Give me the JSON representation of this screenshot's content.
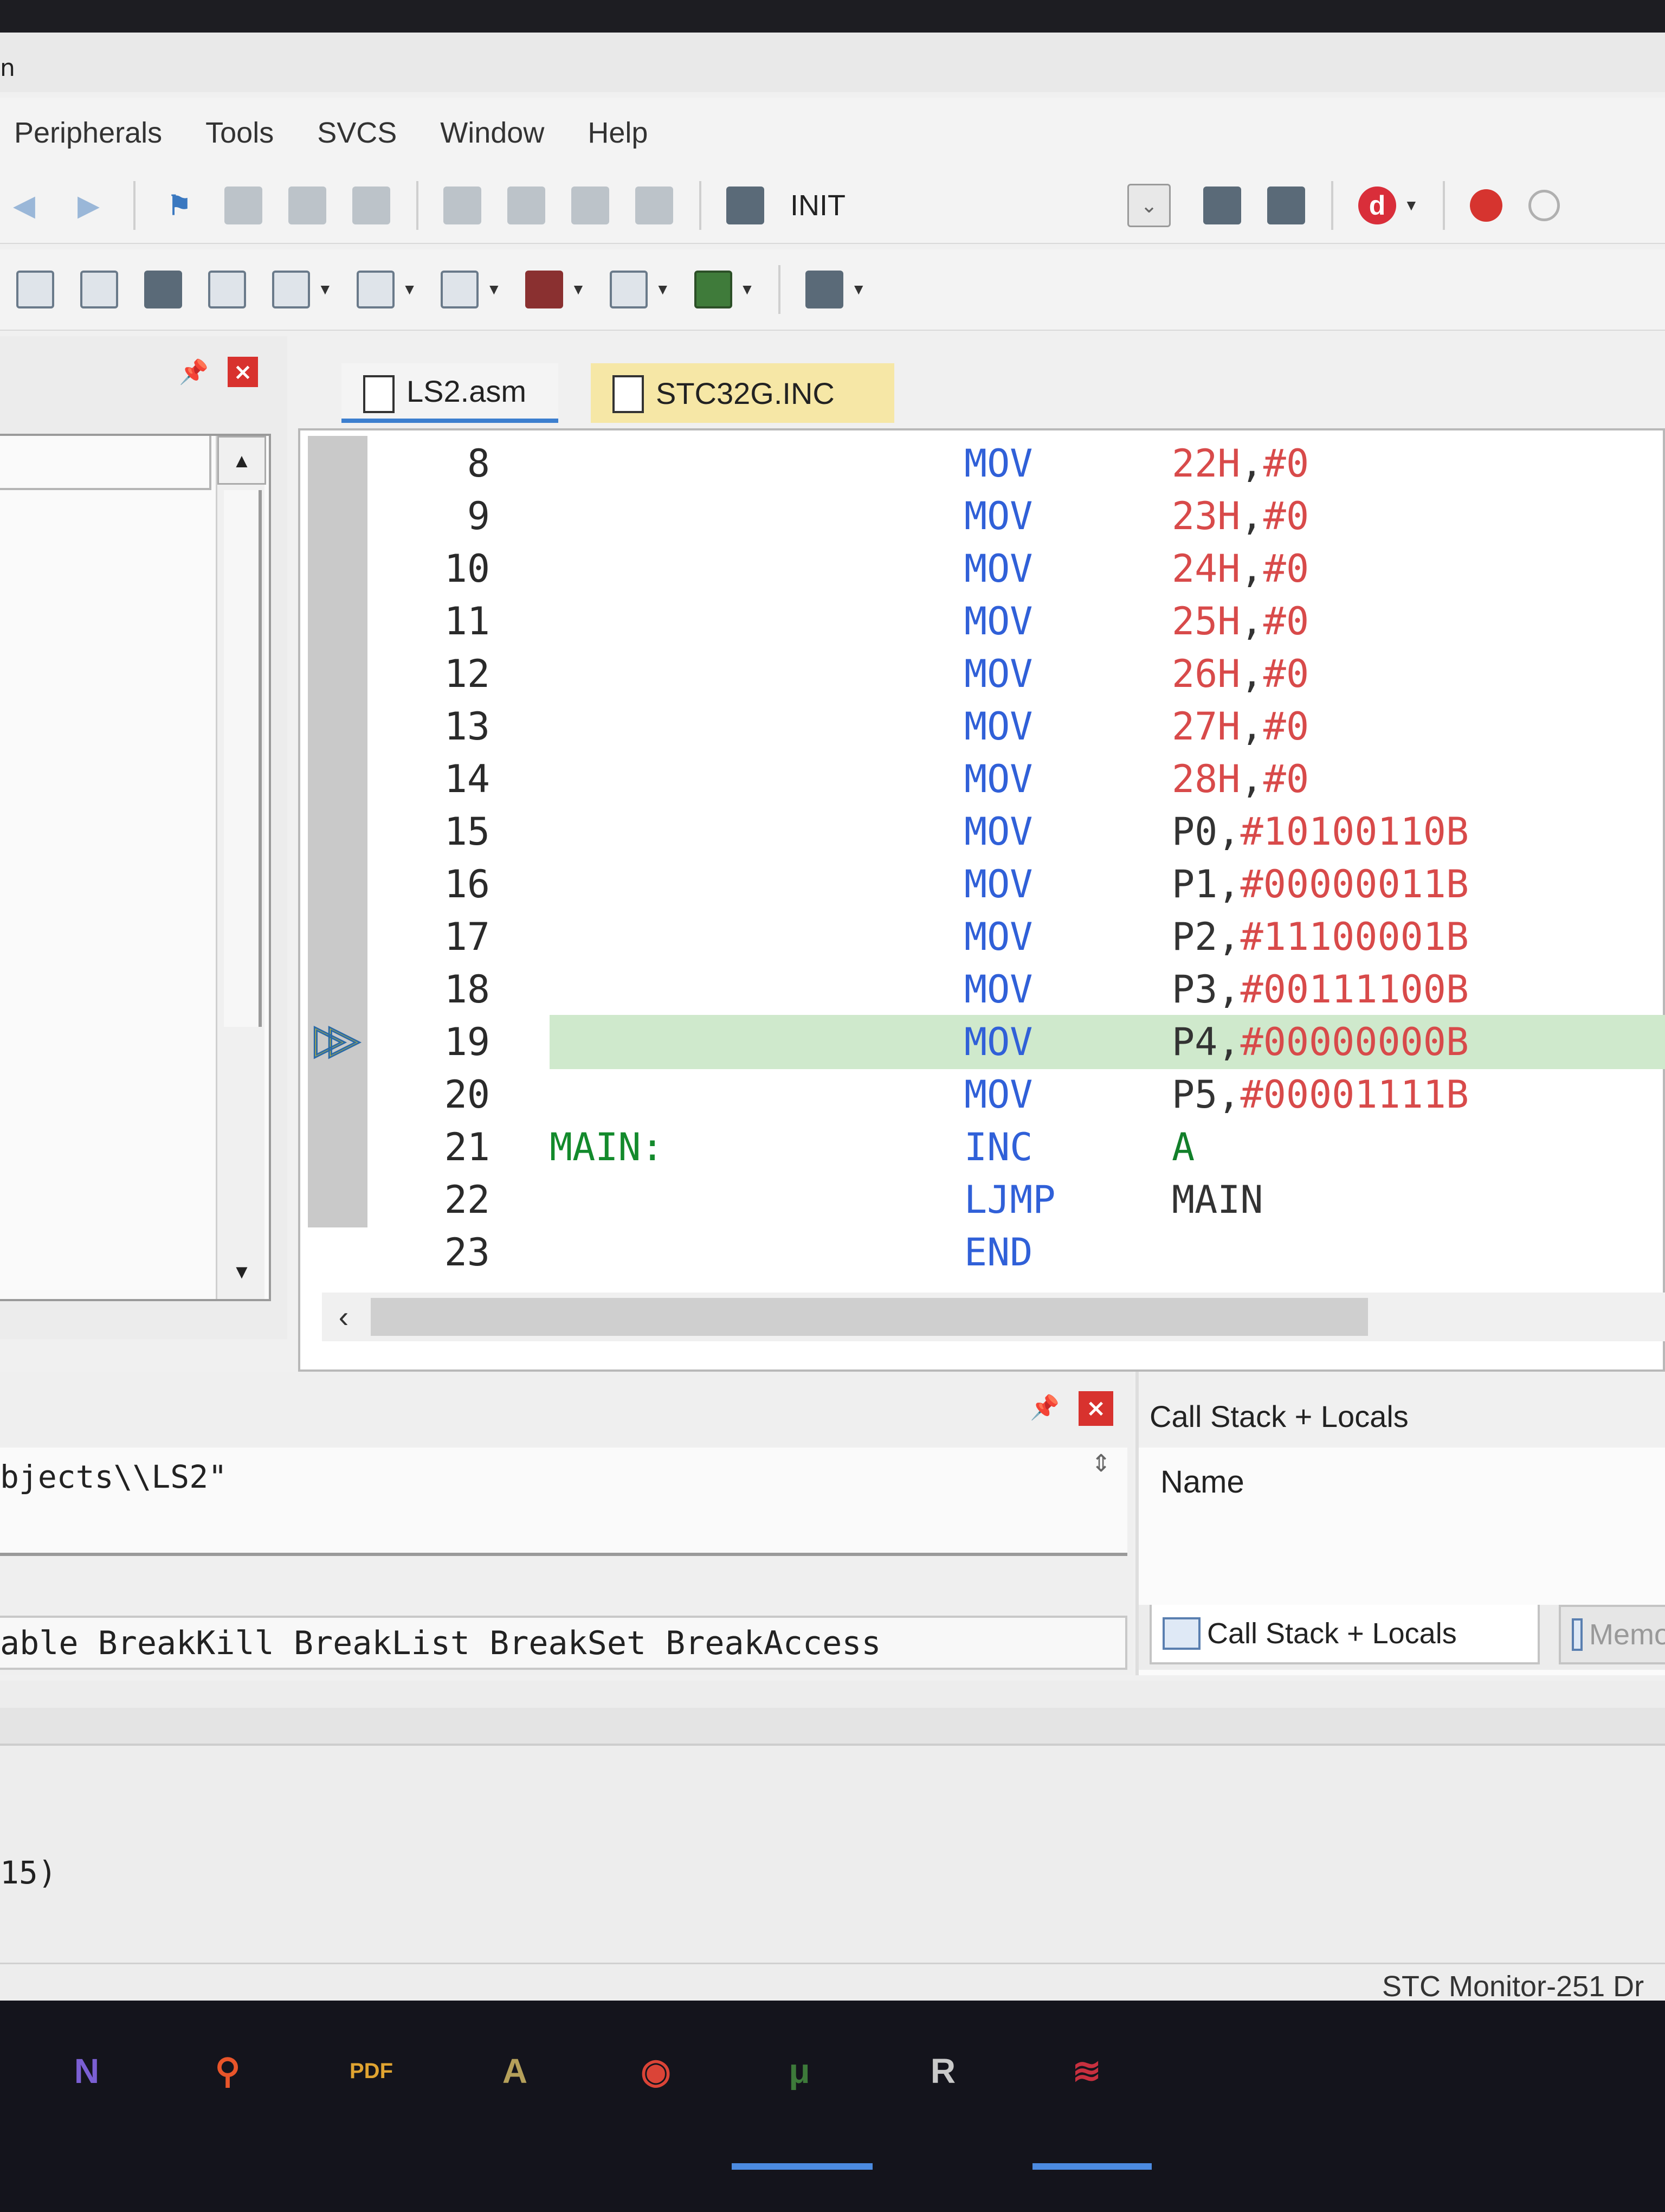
{
  "window": {
    "title_fragment": "n"
  },
  "menu": [
    "Peripherals",
    "Tools",
    "SVCS",
    "Window",
    "Help"
  ],
  "toolbar1": {
    "target_label": "INIT"
  },
  "icons": {
    "back": "arrow-left-icon",
    "forward": "arrow-right-icon",
    "bookmark": "flag-icon",
    "indent": "indent-icon",
    "comment": "comment-icon",
    "load": "load-icon",
    "debug": "debug-icon",
    "breakpoint": "breakpoint-icon"
  },
  "colors": {
    "keyword": "#3060d8",
    "number": "#d84a4a",
    "label": "#138a2c",
    "highlight": "#cfe9cc",
    "tab_active_underline": "#3d7fcf",
    "tab_inc_bg": "#f6e7a6",
    "close_red": "#d8322e"
  },
  "editor": {
    "tabs": [
      {
        "label": "LS2.asm",
        "active": true
      },
      {
        "label": "STC32G.INC",
        "active": false
      }
    ],
    "current_line": 19,
    "lines": [
      {
        "n": "8",
        "label": "",
        "op": "MOV",
        "a1": "22H",
        "a2": "#0"
      },
      {
        "n": "9",
        "label": "",
        "op": "MOV",
        "a1": "23H",
        "a2": "#0"
      },
      {
        "n": "10",
        "label": "",
        "op": "MOV",
        "a1": "24H",
        "a2": "#0"
      },
      {
        "n": "11",
        "label": "",
        "op": "MOV",
        "a1": "25H",
        "a2": "#0"
      },
      {
        "n": "12",
        "label": "",
        "op": "MOV",
        "a1": "26H",
        "a2": "#0"
      },
      {
        "n": "13",
        "label": "",
        "op": "MOV",
        "a1": "27H",
        "a2": "#0"
      },
      {
        "n": "14",
        "label": "",
        "op": "MOV",
        "a1": "28H",
        "a2": "#0"
      },
      {
        "n": "15",
        "label": "",
        "op": "MOV",
        "a1": "P0",
        "a2": "#10100110B"
      },
      {
        "n": "16",
        "label": "",
        "op": "MOV",
        "a1": "P1",
        "a2": "#00000011B"
      },
      {
        "n": "17",
        "label": "",
        "op": "MOV",
        "a1": "P2",
        "a2": "#11100001B"
      },
      {
        "n": "18",
        "label": "",
        "op": "MOV",
        "a1": "P3",
        "a2": "#00111100B"
      },
      {
        "n": "19",
        "label": "",
        "op": "MOV",
        "a1": "P4",
        "a2": "#00000000B"
      },
      {
        "n": "20",
        "label": "",
        "op": "MOV",
        "a1": "P5",
        "a2": "#00001111B"
      },
      {
        "n": "21",
        "label": "MAIN:",
        "op": "INC",
        "a1": "A",
        "a2": ""
      },
      {
        "n": "22",
        "label": "",
        "op": "LJMP",
        "a1": "MAIN",
        "a2": ""
      },
      {
        "n": "23",
        "label": "",
        "op": "END",
        "a1": "",
        "a2": ""
      }
    ]
  },
  "command": {
    "output": "bjects\\\\LS2\"",
    "hint": "able BreakKill BreakList BreakSet BreakAccess"
  },
  "callstack": {
    "title": "Call Stack + Locals",
    "column_name": "Name",
    "tabs": [
      "Call Stack + Locals",
      "Memo"
    ]
  },
  "status": {
    "fragment": "15)",
    "driver": "STC Monitor-251 Dr"
  },
  "taskbar": [
    {
      "name": "visual-studio-icon",
      "glyph": "N",
      "color": "#7b5fd3"
    },
    {
      "name": "search-app-icon",
      "glyph": "⚲",
      "color": "#e8552a"
    },
    {
      "name": "pdf-icon",
      "glyph": "PDF",
      "color": "#e0a431"
    },
    {
      "name": "font-app-icon",
      "glyph": "A",
      "color": "#b5a05a"
    },
    {
      "name": "chrome-icon",
      "glyph": "◉",
      "color": "#db4437"
    },
    {
      "name": "keil-uvision-icon",
      "glyph": "μ",
      "color": "#3d7a3a"
    },
    {
      "name": "can-app-icon",
      "glyph": "R",
      "color": "#c9c9c9"
    },
    {
      "name": "stc-isp-icon",
      "glyph": "≋",
      "color": "#c8303f"
    }
  ]
}
